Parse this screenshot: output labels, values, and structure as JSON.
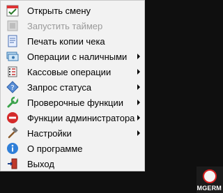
{
  "menu": {
    "items": [
      {
        "label": "Открыть смену",
        "icon": "calendar-check-icon",
        "enabled": true,
        "submenu": false
      },
      {
        "label": "Запустить таймер",
        "icon": "timer-icon",
        "enabled": false,
        "submenu": false
      },
      {
        "label": "Печать копии чека",
        "icon": "receipt-print-icon",
        "enabled": true,
        "submenu": false
      },
      {
        "label": "Операции с наличными",
        "icon": "cash-icon",
        "enabled": true,
        "submenu": true
      },
      {
        "label": "Кассовые операции",
        "icon": "cash-register-icon",
        "enabled": true,
        "submenu": true
      },
      {
        "label": "Запрос статуса",
        "icon": "status-diamond-icon",
        "enabled": true,
        "submenu": true
      },
      {
        "label": "Проверочные функции",
        "icon": "wrench-icon",
        "enabled": true,
        "submenu": true
      },
      {
        "label": "Функции администратора",
        "icon": "no-entry-icon",
        "enabled": true,
        "submenu": true
      },
      {
        "label": "Настройки",
        "icon": "settings-hammer-icon",
        "enabled": true,
        "submenu": true
      },
      {
        "label": "О программе",
        "icon": "info-icon",
        "enabled": true,
        "submenu": false
      },
      {
        "label": "Выход",
        "icon": "exit-door-icon",
        "enabled": true,
        "submenu": false
      }
    ]
  },
  "badge": {
    "text": "MGERM"
  },
  "colors": {
    "menu_background": "#f2f2f2",
    "disabled_text": "#9a9a9a",
    "badge_red": "#d62020"
  }
}
